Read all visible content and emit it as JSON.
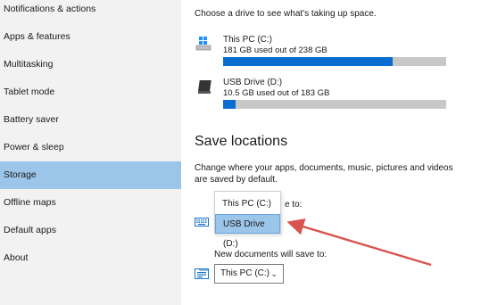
{
  "sidebar": {
    "items": [
      {
        "label": "Notifications & actions"
      },
      {
        "label": "Apps & features"
      },
      {
        "label": "Multitasking"
      },
      {
        "label": "Tablet mode"
      },
      {
        "label": "Battery saver"
      },
      {
        "label": "Power & sleep"
      },
      {
        "label": "Storage",
        "selected": true
      },
      {
        "label": "Offline maps"
      },
      {
        "label": "Default apps"
      },
      {
        "label": "About"
      }
    ]
  },
  "storage": {
    "intro": "Choose a drive to see what's taking up space.",
    "drives": [
      {
        "name": "This PC (C:)",
        "usage": "181 GB used out of 238 GB",
        "used_fraction": 0.76,
        "icon": "windows-drive-icon"
      },
      {
        "name": "USB Drive (D:)",
        "usage": "10.5 GB used out of 183 GB",
        "used_fraction": 0.057,
        "icon": "usb-drive-icon"
      }
    ]
  },
  "save_locations": {
    "title": "Save locations",
    "description": "Change where your apps, documents, music, pictures and videos are saved by default.",
    "apps_label_tail": "e to:",
    "apps_dropdown": {
      "options": [
        "This PC (C:)",
        "USB Drive (D:)"
      ],
      "highlighted": "USB Drive (D:)"
    },
    "documents_label": "New documents will save to:",
    "documents_select": {
      "value": "This PC (C:)"
    }
  },
  "colors": {
    "accent": "#0a6ed1",
    "selection": "#9cc5ea",
    "arrow": "#d9534f"
  }
}
